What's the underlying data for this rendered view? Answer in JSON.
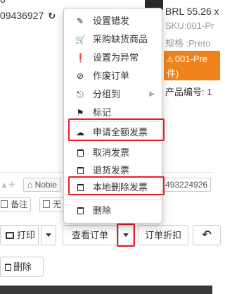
{
  "order": {
    "id_fragment": "09436927",
    "refresh_icon": "refresh-icon"
  },
  "product": {
    "price": "BRL 55.26 x",
    "sku": "SKU:001-Pr",
    "spec": "规格 :Preto",
    "warning": "⚠ 001-Pre\n件)",
    "warning_line1": "001-Pre",
    "warning_line2": "件)",
    "product_no": "产品编号: 1",
    "warning_color": "#f0821e"
  },
  "shipping": {
    "tag": "Nobie",
    "tracking": "493224926"
  },
  "notes": {
    "note_label": "备注",
    "none_label": "无"
  },
  "toolbar": {
    "print_label": "打印",
    "view_order_label": "查看订单",
    "order_discount_label": "订单折扣",
    "delete_label": "删除"
  },
  "menu": {
    "items": [
      {
        "label": "设置错发",
        "icon": "edit-icon"
      },
      {
        "label": "采购缺货商品",
        "icon": "cart-icon"
      },
      {
        "label": "设置为异常",
        "icon": "exclamation-icon"
      },
      {
        "label": "作废订单",
        "icon": "ban-icon"
      },
      {
        "label": "分组到",
        "icon": "sitemap-icon",
        "submenu": true
      },
      {
        "label": "标记",
        "icon": "tag-icon"
      },
      {
        "label": "申请全额发票",
        "icon": "cloud-upload-icon"
      },
      {
        "label": "取消发票",
        "icon": "trash-icon"
      },
      {
        "label": "退货发票",
        "icon": "trash-icon"
      },
      {
        "label": "本地删除发票",
        "icon": "trash-icon"
      },
      {
        "label": "删除",
        "icon": "trash-icon"
      }
    ]
  },
  "colors": {
    "highlight": "#e8202a",
    "accent": "#f0821e"
  }
}
